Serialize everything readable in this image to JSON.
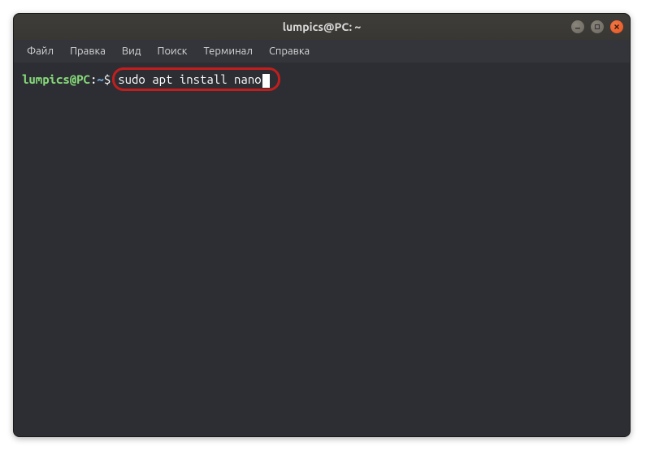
{
  "window": {
    "title": "lumpics@PC: ~"
  },
  "menu": {
    "items": [
      "Файл",
      "Правка",
      "Вид",
      "Поиск",
      "Терминал",
      "Справка"
    ]
  },
  "terminal": {
    "prompt_user": "lumpics@PC",
    "prompt_colon": ":",
    "prompt_path": "~",
    "prompt_dollar": "$",
    "command": "sudo apt install nano"
  }
}
